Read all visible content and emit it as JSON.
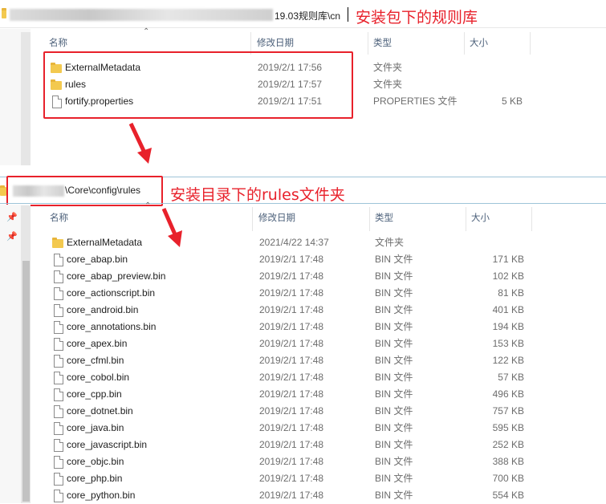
{
  "top": {
    "path_text": "19.03规则库\\cn",
    "annotation": "安装包下的规则库",
    "columns": {
      "name": "名称",
      "date": "修改日期",
      "type": "类型",
      "size": "大小"
    },
    "rows": [
      {
        "name": "ExternalMetadata",
        "date": "2019/2/1 17:56",
        "type": "文件夹",
        "size": "",
        "icon": "folder-icon"
      },
      {
        "name": "rules",
        "date": "2019/2/1 17:57",
        "type": "文件夹",
        "size": "",
        "icon": "folder-icon"
      },
      {
        "name": "fortify.properties",
        "date": "2019/2/1 17:51",
        "type": "PROPERTIES 文件",
        "size": "5 KB",
        "icon": "file-icon"
      }
    ]
  },
  "bottom": {
    "path_text": "\\Core\\config\\rules",
    "annotation": "安装目录下的rules文件夹",
    "columns": {
      "name": "名称",
      "date": "修改日期",
      "type": "类型",
      "size": "大小"
    },
    "rows": [
      {
        "name": "ExternalMetadata",
        "date": "2021/4/22 14:37",
        "type": "文件夹",
        "size": "",
        "icon": "folder-icon"
      },
      {
        "name": "core_abap.bin",
        "date": "2019/2/1 17:48",
        "type": "BIN 文件",
        "size": "171 KB",
        "icon": "file-icon"
      },
      {
        "name": "core_abap_preview.bin",
        "date": "2019/2/1 17:48",
        "type": "BIN 文件",
        "size": "102 KB",
        "icon": "file-icon"
      },
      {
        "name": "core_actionscript.bin",
        "date": "2019/2/1 17:48",
        "type": "BIN 文件",
        "size": "81 KB",
        "icon": "file-icon"
      },
      {
        "name": "core_android.bin",
        "date": "2019/2/1 17:48",
        "type": "BIN 文件",
        "size": "401 KB",
        "icon": "file-icon"
      },
      {
        "name": "core_annotations.bin",
        "date": "2019/2/1 17:48",
        "type": "BIN 文件",
        "size": "194 KB",
        "icon": "file-icon"
      },
      {
        "name": "core_apex.bin",
        "date": "2019/2/1 17:48",
        "type": "BIN 文件",
        "size": "153 KB",
        "icon": "file-icon"
      },
      {
        "name": "core_cfml.bin",
        "date": "2019/2/1 17:48",
        "type": "BIN 文件",
        "size": "122 KB",
        "icon": "file-icon"
      },
      {
        "name": "core_cobol.bin",
        "date": "2019/2/1 17:48",
        "type": "BIN 文件",
        "size": "57 KB",
        "icon": "file-icon"
      },
      {
        "name": "core_cpp.bin",
        "date": "2019/2/1 17:48",
        "type": "BIN 文件",
        "size": "496 KB",
        "icon": "file-icon"
      },
      {
        "name": "core_dotnet.bin",
        "date": "2019/2/1 17:48",
        "type": "BIN 文件",
        "size": "757 KB",
        "icon": "file-icon"
      },
      {
        "name": "core_java.bin",
        "date": "2019/2/1 17:48",
        "type": "BIN 文件",
        "size": "595 KB",
        "icon": "file-icon"
      },
      {
        "name": "core_javascript.bin",
        "date": "2019/2/1 17:48",
        "type": "BIN 文件",
        "size": "252 KB",
        "icon": "file-icon"
      },
      {
        "name": "core_objc.bin",
        "date": "2019/2/1 17:48",
        "type": "BIN 文件",
        "size": "388 KB",
        "icon": "file-icon"
      },
      {
        "name": "core_php.bin",
        "date": "2019/2/1 17:48",
        "type": "BIN 文件",
        "size": "700 KB",
        "icon": "file-icon"
      },
      {
        "name": "core_python.bin",
        "date": "2019/2/1 17:48",
        "type": "BIN 文件",
        "size": "554 KB",
        "icon": "file-icon"
      }
    ]
  },
  "colors": {
    "annotation_red": "#e8212b",
    "header_text": "#4c607a",
    "folder_yellow": "#f3c94f"
  }
}
